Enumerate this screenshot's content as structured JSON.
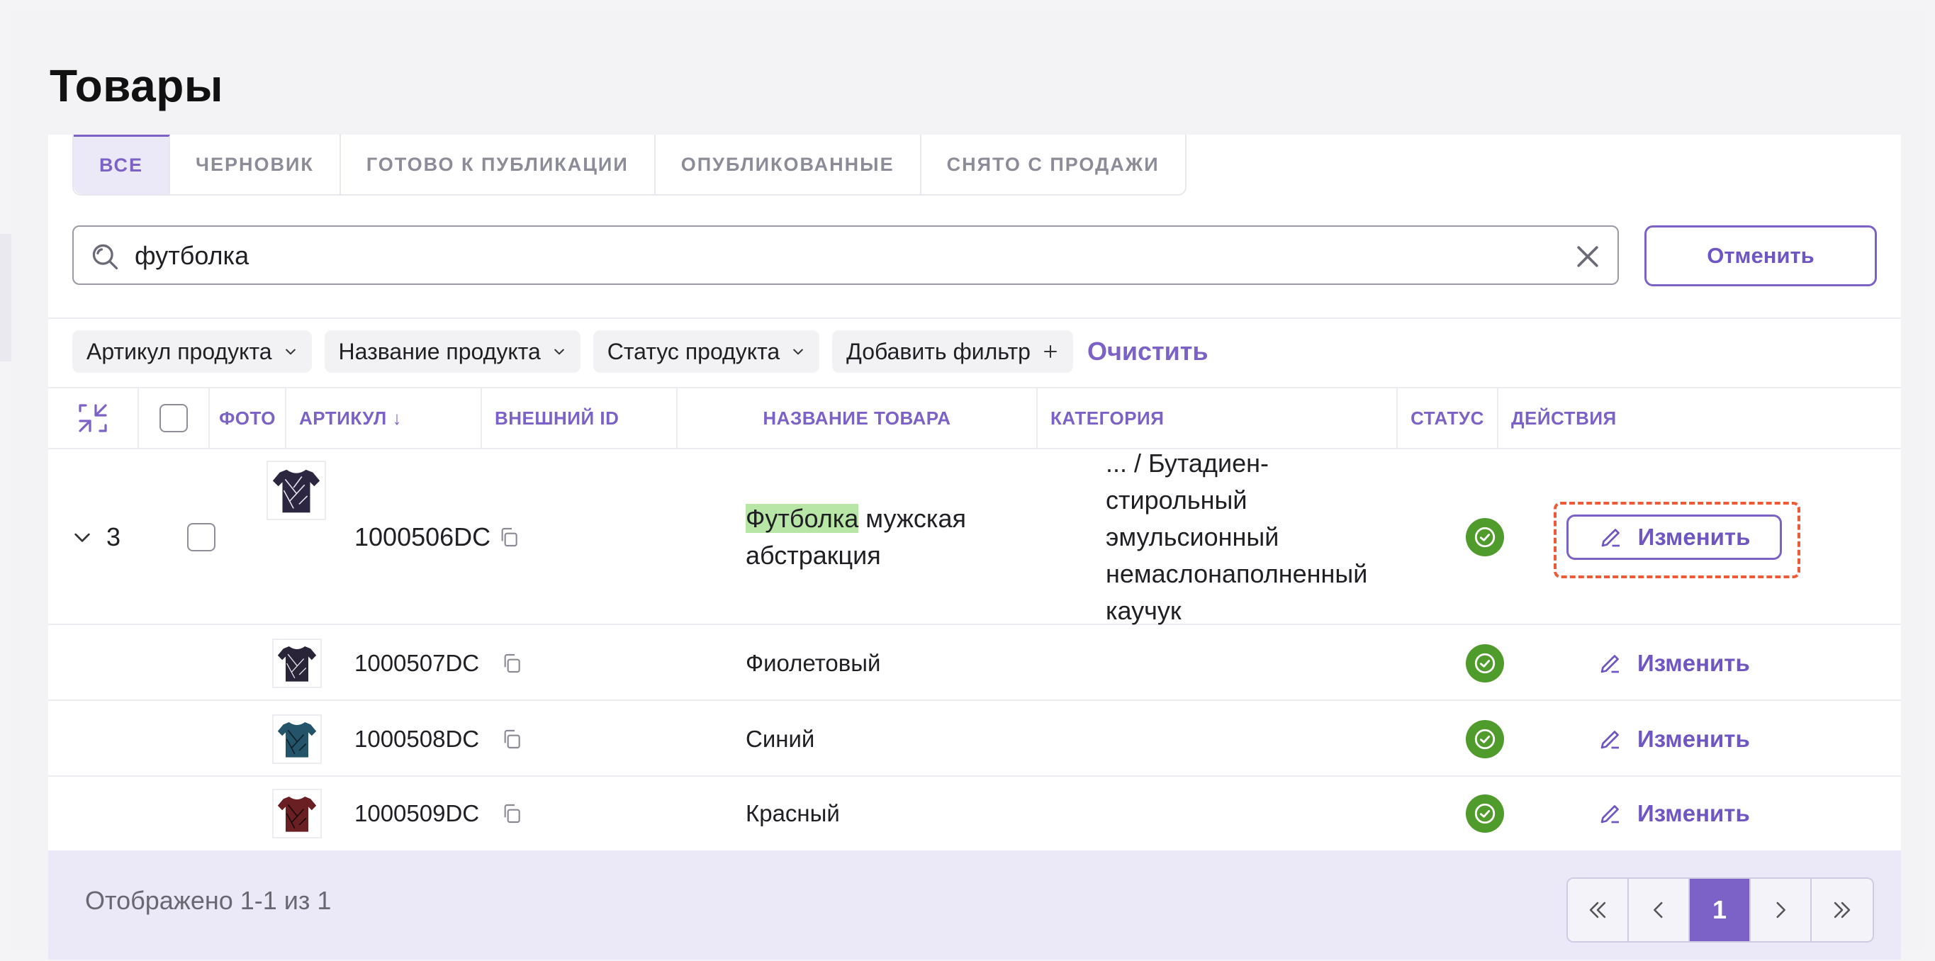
{
  "page": {
    "title": "Товары"
  },
  "tabs": [
    {
      "label": "ВСЕ",
      "active": true
    },
    {
      "label": "ЧЕРНОВИК",
      "active": false
    },
    {
      "label": "ГОТОВО К ПУБЛИКАЦИИ",
      "active": false
    },
    {
      "label": "ОПУБЛИКОВАННЫЕ",
      "active": false
    },
    {
      "label": "СНЯТО С ПРОДАЖИ",
      "active": false
    }
  ],
  "search": {
    "value": "футболка",
    "cancel_label": "Отменить"
  },
  "filters": {
    "chips": [
      "Артикул продукта",
      "Название продукта",
      "Статус продукта",
      "Добавить фильтр"
    ],
    "clear_label": "Очистить"
  },
  "table": {
    "headers": {
      "photo": "ФОТО",
      "sku": "АРТИКУЛ ↓",
      "external_id": "ВНЕШНИЙ ID",
      "name": "НАЗВАНИЕ ТОВАРА",
      "category": "КАТЕГОРИЯ",
      "status": "СТАТУС",
      "actions": "ДЕЙСТВИЯ"
    },
    "parent": {
      "variants_count": "3",
      "sku": "1000506DC",
      "name_highlight": "Футболка",
      "name_rest": " мужская абстракция",
      "category": "... / Бутадиен-стирольный эмульсионный немаслонаполненный каучук",
      "status": "published",
      "action_label": "Изменить"
    },
    "variants": [
      {
        "sku": "1000507DC",
        "name": "Фиолетовый",
        "status": "published",
        "action_label": "Изменить",
        "shirt_color": "#2a2438"
      },
      {
        "sku": "1000508DC",
        "name": "Синий",
        "status": "published",
        "action_label": "Изменить",
        "shirt_color": "#24546a"
      },
      {
        "sku": "1000509DC",
        "name": "Красный",
        "status": "published",
        "action_label": "Изменить",
        "shirt_color": "#6a1f22"
      }
    ]
  },
  "footer": {
    "summary": "Отображено 1-1 из 1",
    "current_page": "1"
  },
  "colors": {
    "accent": "#7c62c7",
    "status_ok": "#4f9b2b",
    "focus": "#ee5a36",
    "highlight": "#b8e6a6"
  }
}
